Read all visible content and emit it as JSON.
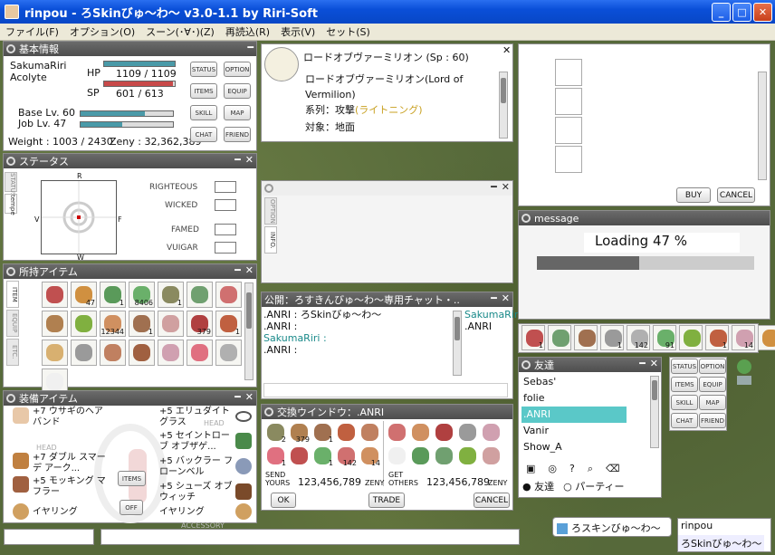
{
  "window": {
    "title": "rinpou - ろSkinびゅ〜わ〜 v3.0-1.1 by Riri-Soft",
    "min": "_",
    "max": "□",
    "close": "✕"
  },
  "menu": [
    "ファイル(F)",
    "オプション(O)",
    "スーン(･∀･)(Z)",
    "再読込(R)",
    "表示(V)",
    "セット(S)"
  ],
  "basic": {
    "title": "基本情報",
    "name": "SakumaRiri",
    "job": "Acolyte",
    "hp_label": "HP",
    "hp": "1109 / 1109",
    "sp_label": "SP",
    "sp": "601 / 613",
    "hp_ratio": 1.0,
    "sp_ratio": 0.98,
    "base_lv": "Base Lv. 60",
    "job_lv": "Job Lv. 47",
    "base_exp_ratio": 0.7,
    "job_exp_ratio": 0.45,
    "weight": "Weight : 1003 / 2430",
    "zeny": "Zeny : 32,362,389",
    "buttons": [
      "STATUS",
      "OPTION",
      "ITEMS",
      "EQUIP",
      "SKILL",
      "MAP",
      "CHAT",
      "FRIEND"
    ],
    "hp_color": "#4a9aa8",
    "sp_color": "#c84a4a"
  },
  "status": {
    "title": "ステータス",
    "tabs": [
      "STATUS",
      "tempe"
    ],
    "axis": {
      "top": "R",
      "left": "V",
      "right": "F",
      "bottom": "W"
    },
    "labels": [
      "RIGHTEOUS",
      "WICKED",
      "FAMED",
      "VUIGAR"
    ]
  },
  "items": {
    "title": "所持アイテム",
    "tabs": [
      "ITEM",
      "EQUIP",
      "ETC."
    ],
    "counts": [
      "",
      "47",
      "1",
      "8406",
      "1",
      "",
      "",
      "",
      "",
      "12344",
      "1",
      "",
      "379",
      "1",
      "",
      "",
      "",
      "",
      "",
      "",
      "",
      ""
    ]
  },
  "equip": {
    "title": "装備アイテム",
    "head_label": "HEAD",
    "acc_label": "ACCESSORY",
    "items_btn": "ITEMS",
    "off_btn": "OFF",
    "left": [
      "+7 ウサギのヘアバンド",
      "+7 ダブル スマーデ アーク...",
      "+5 モッキング マフラー",
      "イヤリング"
    ],
    "right": [
      "+5 エリュダイト グラス",
      "+5 セイントローブ オブザゲ...",
      "+5 バックラー フローンベル",
      "+5 シューズ オブ ウィッチ",
      "イヤリング"
    ]
  },
  "skill": {
    "title": "ロードオブヴァーミリオン (Sp : 60)",
    "desc_name": "ロードオブヴァーミリオン(Lord of Vermilion)",
    "type_label": "系列：攻撃",
    "type_value": "(ライトニング)",
    "target": "対象：地面"
  },
  "info": {
    "tabs": [
      "OPTION",
      "INFO."
    ]
  },
  "chat": {
    "title": "公開：ろすきんびゅ〜わ〜専用チャット・..",
    "lines": [
      ".ANRI : ろSkinびゅ〜わ〜",
      ".ANRI :",
      "SakumaRiri :",
      ".ANRI :"
    ],
    "members": [
      "SakumaRiri",
      ".ANRI"
    ]
  },
  "trade": {
    "title": "交換ウインドウ：.ANRI",
    "send": "SEND",
    "yours": "YOURS",
    "get": "GET",
    "others": "OTHERS",
    "my_zeny": "123,456,789",
    "their_zeny": "123,456,789",
    "zeny_label": "ZENY",
    "ok": "OK",
    "trade": "TRADE",
    "cancel": "CANCEL",
    "my_counts": [
      "2",
      "379",
      "1",
      "",
      "",
      "1",
      "",
      "1",
      "142",
      "14"
    ],
    "their_counts": [
      "",
      "",
      "",
      "",
      "",
      "",
      "",
      "",
      "",
      ""
    ]
  },
  "shop": {
    "buy": "BUY",
    "cancel": "CANCEL"
  },
  "message": {
    "title": "message",
    "text": "Loading 47 %",
    "progress": 0.47
  },
  "hotkeys": {
    "counts": [
      "1",
      "",
      "",
      "1",
      "142",
      "91",
      "",
      "1",
      "14",
      ""
    ]
  },
  "friends": {
    "title": "友達",
    "list": [
      "Sebas'",
      "folie",
      ".ANRI",
      "Vanir",
      "Show_A"
    ],
    "selected": ".ANRI",
    "radio1": "友達",
    "radio2": "パーティー"
  },
  "mini": {
    "buttons": [
      "STATUS",
      "OPTION",
      "ITEMS",
      "EQUIP",
      "SKILL",
      "MAP",
      "CHAT",
      "FRIEND"
    ]
  },
  "bottom": {
    "chat_item": "ろスキンびゅ〜わ〜",
    "name": "rinpou",
    "sub": "ろSkinびゅ〜わ〜"
  }
}
